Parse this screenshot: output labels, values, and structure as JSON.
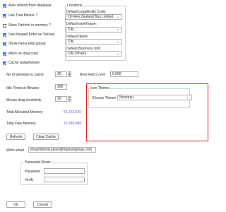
{
  "checkboxes": [
    {
      "label": "Auto refresh from database",
      "checked": true
    },
    {
      "label": "Use Tree Menus ?",
      "checked": true
    },
    {
      "label": "Store PartInfo in memory ?",
      "checked": false
    },
    {
      "label": "Use Keypad Enter as Tab key",
      "checked": true
    },
    {
      "label": "Show menu help popup",
      "checked": true
    },
    {
      "label": "Warn on drag copy",
      "checked": true
    },
    {
      "label": "Cache Subwindows",
      "checked": true
    }
  ],
  "locations": {
    "title": "Locations",
    "legal_label": "Default LegalEntity Code:",
    "legal_value": "10-New Zealand Bus Limited",
    "warehouse_label": "Default warehouse:",
    "warehouse_value": "City",
    "depot_label": "Default depot:",
    "depot_value": "City",
    "business_unit_label": "Default Business Unit:",
    "business_unit_value": "City Drivers"
  },
  "settings": {
    "windows_cache_label": "No of windows to cache",
    "windows_cache_value": "20",
    "row_fetch_label": "Row Fetch Limit",
    "row_fetch_value": "5,000",
    "idle_timeout_label": "Idle Timeout Minutes",
    "idle_timeout_value": "300",
    "mouse_drag_label": "Mouse drag sensitivity",
    "mouse_drag_value": "20"
  },
  "memory": {
    "allocated_label": "Total Allocated Memory",
    "allocated_value": "52,152,536",
    "free_label": "Total Free Memory",
    "free_value": "13,365,848"
  },
  "icon_theme": {
    "title": "Icon Theme",
    "choose_label": "Choose Theme",
    "choose_value": "Nouveau"
  },
  "buttons": {
    "refresh": "Refresh",
    "clear_cache": "Clear Cache",
    "ok": "Ok",
    "cancel": "Cancel"
  },
  "work_email": {
    "label": "Work email",
    "value": "tmsproductsupport@trapezegroup.com"
  },
  "password_reset": {
    "title": "Password Reset",
    "password_label": "Password",
    "verify_label": "Verify"
  },
  "colors": {
    "accent": "#2f6fd6",
    "highlight_box": "#e02020",
    "memory_value": "#6a4fc2"
  }
}
